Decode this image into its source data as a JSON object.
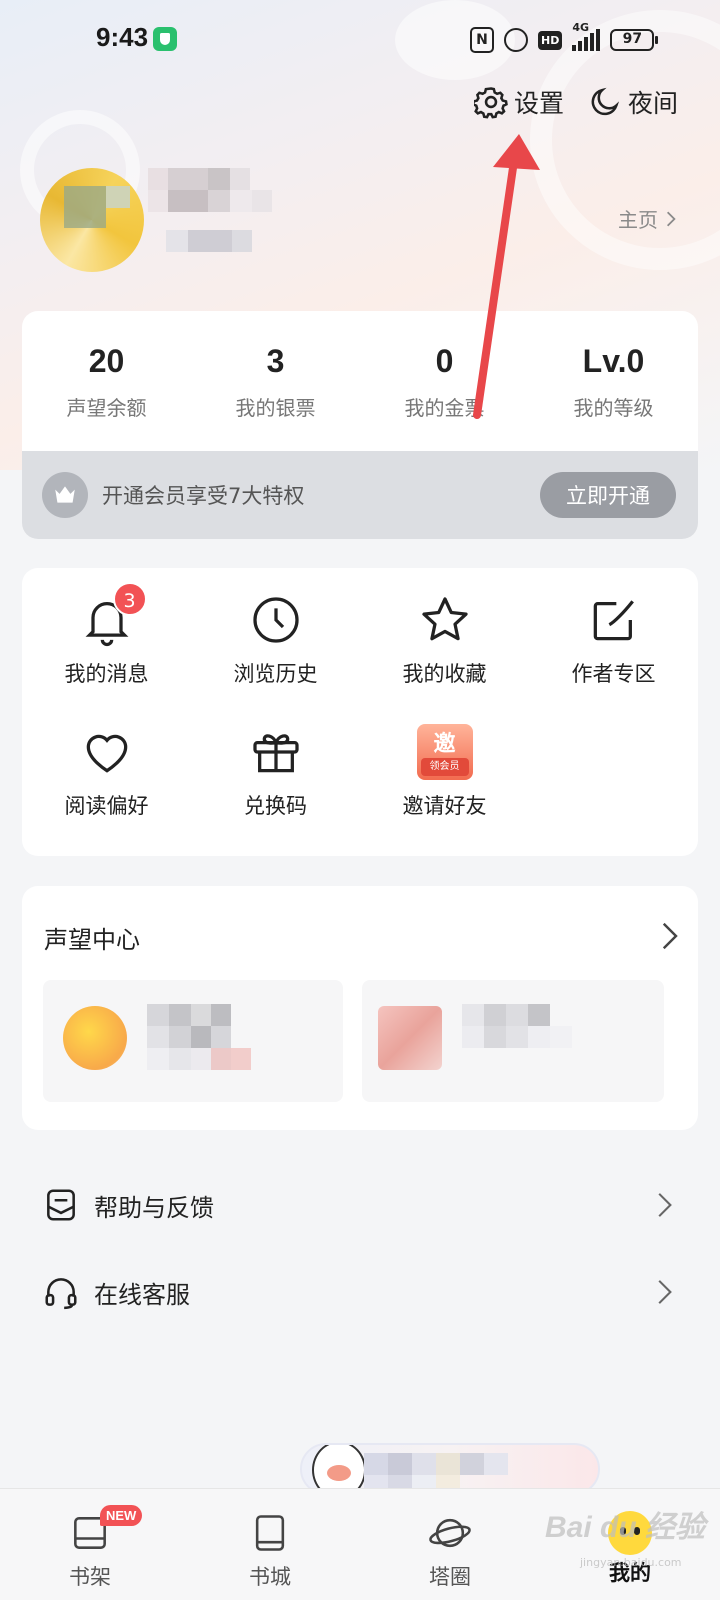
{
  "status_bar": {
    "time": "9:43",
    "network": "4G",
    "hd": "HD",
    "battery": "97"
  },
  "header": {
    "settings_label": "设置",
    "night_label": "夜间"
  },
  "profile": {
    "homepage_link": "主页"
  },
  "stats": [
    {
      "value": "20",
      "label": "声望余额"
    },
    {
      "value": "3",
      "label": "我的银票"
    },
    {
      "value": "0",
      "label": "我的金票"
    },
    {
      "value": "Lv.0",
      "label": "我的等级"
    }
  ],
  "vip": {
    "text": "开通会员享受7大特权",
    "button": "立即开通"
  },
  "features": [
    {
      "label": "我的消息",
      "icon": "bell-icon",
      "badge": "3"
    },
    {
      "label": "浏览历史",
      "icon": "clock-icon"
    },
    {
      "label": "我的收藏",
      "icon": "star-icon"
    },
    {
      "label": "作者专区",
      "icon": "edit-icon"
    },
    {
      "label": "阅读偏好",
      "icon": "heart-icon"
    },
    {
      "label": "兑换码",
      "icon": "gift-icon"
    },
    {
      "label": "邀请好友",
      "icon": "invite-icon",
      "icon_text": "邀",
      "icon_sub": "领会员"
    }
  ],
  "reputation": {
    "title": "声望中心"
  },
  "list": [
    {
      "label": "帮助与反馈",
      "icon": "feedback-icon"
    },
    {
      "label": "在线客服",
      "icon": "headset-icon"
    }
  ],
  "bottom_nav": [
    {
      "label": "书架",
      "icon": "bookshelf-icon",
      "badge": "NEW"
    },
    {
      "label": "书城",
      "icon": "book-icon"
    },
    {
      "label": "塔圈",
      "icon": "planet-icon"
    },
    {
      "label": "我的",
      "icon": "profile-face-icon",
      "active": true
    }
  ],
  "watermark": {
    "text": "Bai du 经验",
    "sub": "jingyan.baidu.com"
  },
  "colors": {
    "annotation_arrow": "#e8474a",
    "badge_red": "#f25255",
    "vip_strip": "#dcdee2"
  }
}
